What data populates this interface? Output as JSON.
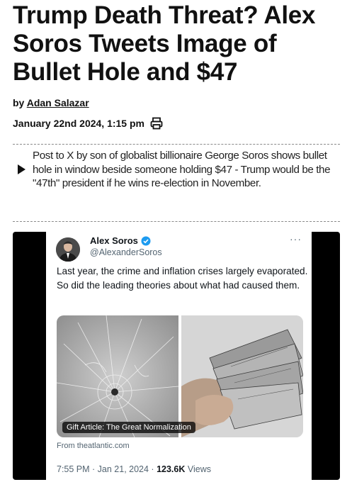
{
  "article": {
    "headline": "Trump Death Threat? Alex Soros Tweets Image of Bullet Hole and $47",
    "byline_prefix": "by",
    "author": "Adan Salazar",
    "date": "January 22nd 2024, 1:15 pm",
    "summary": "Post to X by son of globalist billionaire George Soros shows bullet hole in window beside someone holding $47 - Trump would be the \"47th\" president if he wins re-election in November."
  },
  "tweet": {
    "author_name": "Alex Soros",
    "handle": "@AlexanderSoros",
    "more": "···",
    "text": "Last year, the crime and inflation crises largely evaporated. So did the leading theories about what had caused them.",
    "card_label": "Gift Article: The Great Normalization",
    "card_source": "From theatlantic.com",
    "time": "7:55 PM · Jan 21, 2024 · ",
    "views_count": "123.6K",
    "views_label": " Views"
  },
  "icons": {
    "print": "print-icon",
    "summary_arrow": "play-arrow-icon",
    "verified": "verified-badge-icon",
    "more": "more-dots-icon"
  },
  "colors": {
    "verified": "#1d9bf0",
    "secondary_text": "#536471"
  }
}
